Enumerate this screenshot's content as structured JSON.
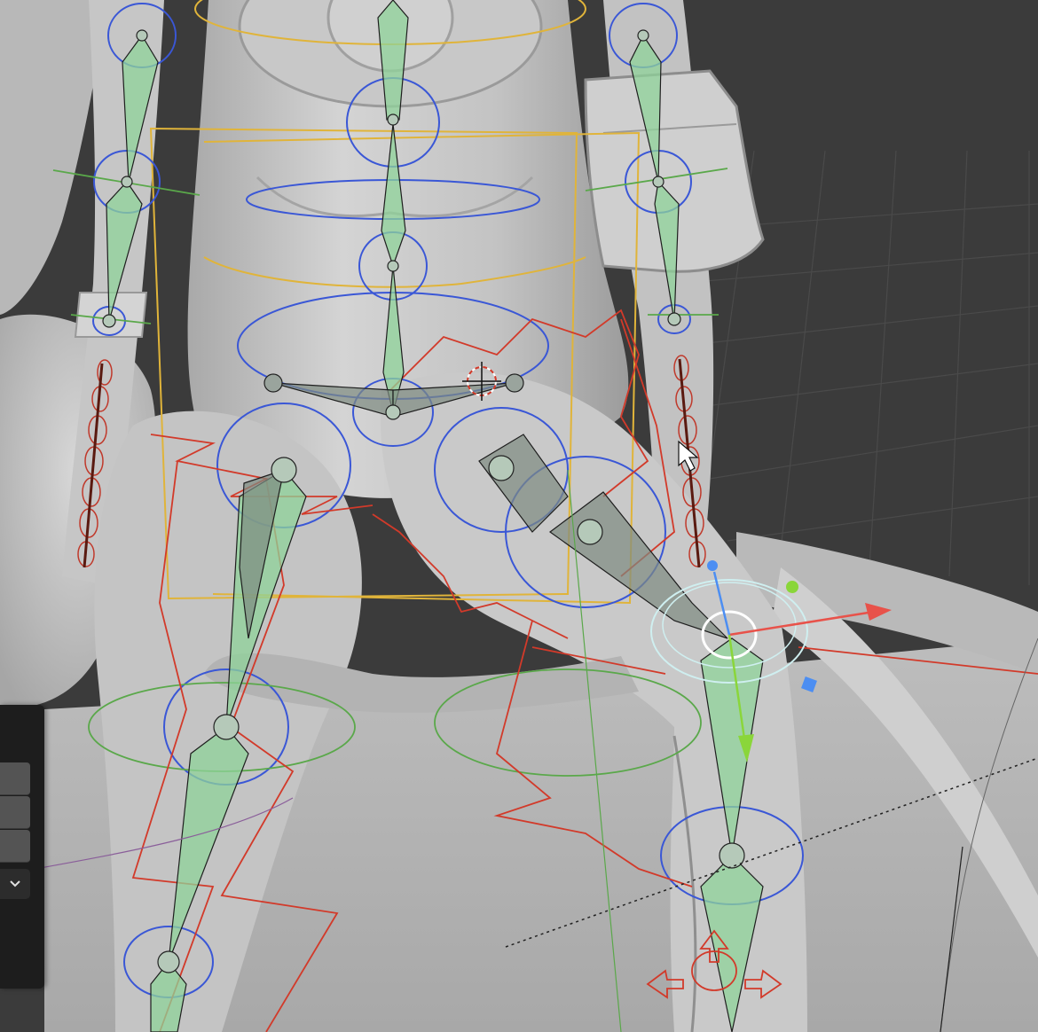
{
  "app": {
    "name": "3D viewport",
    "mode": "pose"
  },
  "viewport": {
    "background": "#3b3b3b",
    "mesh_color": "#c9c9c9",
    "grid_color": "#4a4a4a",
    "bone_fill_color": "#8fd39a",
    "bone_outline_color": "#1e1e1e",
    "control_circle_color": "#3a57d6",
    "ik_control_color": "#d23a2a",
    "root_box_color": "#e0b43a",
    "active_bone_color": "#cfeff0"
  },
  "gizmo": {
    "x_axis_color": "#e8524a",
    "y_axis_color": "#8ad63a",
    "z_axis_color": "#4c8ef2"
  },
  "side_panel": {
    "fields": [
      "",
      "",
      ""
    ],
    "dropdown_icon": "chevron-down-icon"
  },
  "cursor": {
    "icon": "pointer-cursor-icon"
  }
}
